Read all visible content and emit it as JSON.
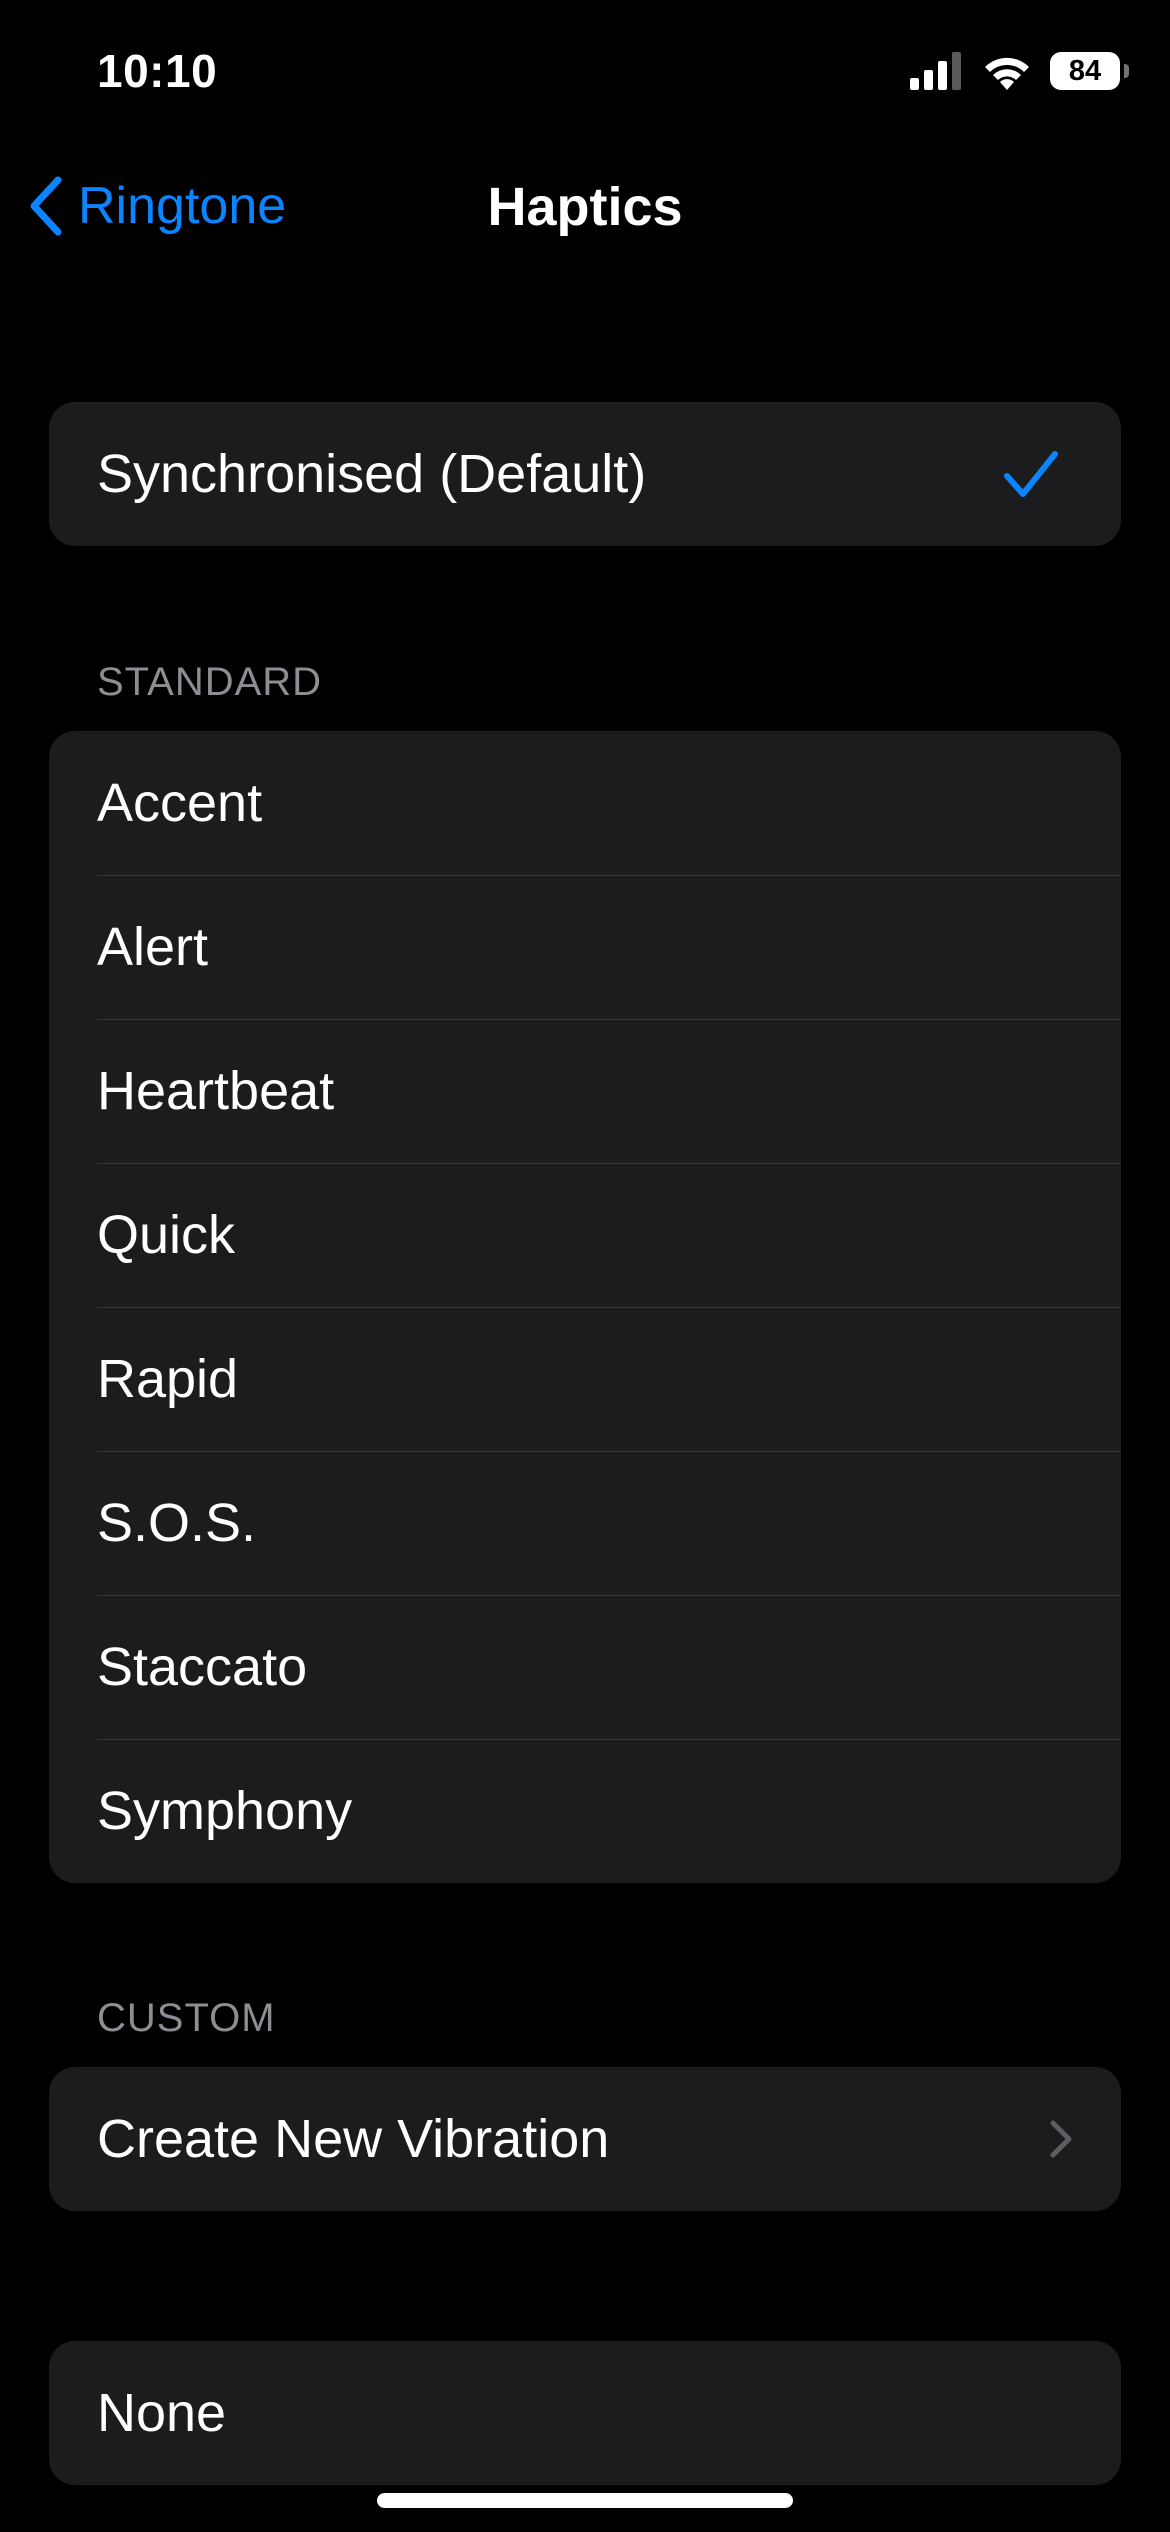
{
  "status_bar": {
    "time": "10:10",
    "battery_level": "84",
    "icons": [
      "signal-icon",
      "wifi-icon",
      "battery-icon"
    ]
  },
  "nav": {
    "back_label": "Ringtone",
    "title": "Haptics"
  },
  "default_option": {
    "label": "Synchronised (Default)",
    "selected": true
  },
  "standard": {
    "header": "STANDARD",
    "items": [
      {
        "label": "Accent"
      },
      {
        "label": "Alert"
      },
      {
        "label": "Heartbeat"
      },
      {
        "label": "Quick"
      },
      {
        "label": "Rapid"
      },
      {
        "label": "S.O.S."
      },
      {
        "label": "Staccato"
      },
      {
        "label": "Symphony"
      }
    ]
  },
  "custom": {
    "header": "CUSTOM",
    "create_label": "Create New Vibration"
  },
  "none_option": {
    "label": "None"
  },
  "colors": {
    "accent": "#0a84ff",
    "background": "#000000",
    "cell": "#1c1c1e",
    "separator": "#38383a",
    "secondary_text": "#8d8d93"
  }
}
